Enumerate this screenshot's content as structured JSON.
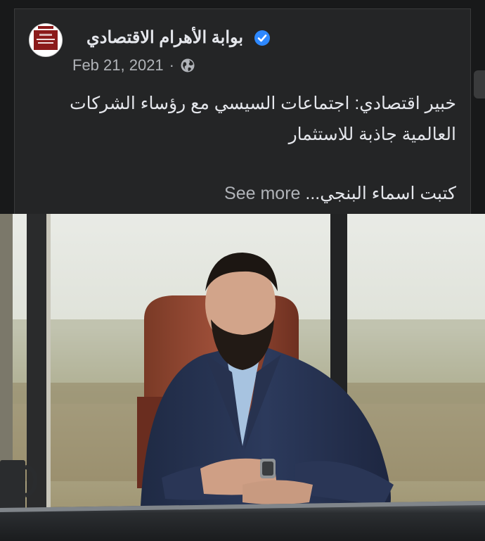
{
  "post": {
    "page_name": "بوابة الأهرام الاقتصادي",
    "date": "Feb 21, 2021",
    "separator": "·",
    "text": "خبير اقتصادي: اجتماعات السيسي مع رؤساء الشركات العالمية جاذبة للاستثمار",
    "byline": "كتبت اسماء البنجي...",
    "see_more": "See more",
    "verified_icon": "verified-badge-icon",
    "privacy_icon": "globe-icon"
  },
  "colors": {
    "background": "#18191a",
    "card": "#242526",
    "primary_text": "#e4e6eb",
    "secondary_text": "#b0b3b8",
    "verified": "#2d88ff"
  }
}
